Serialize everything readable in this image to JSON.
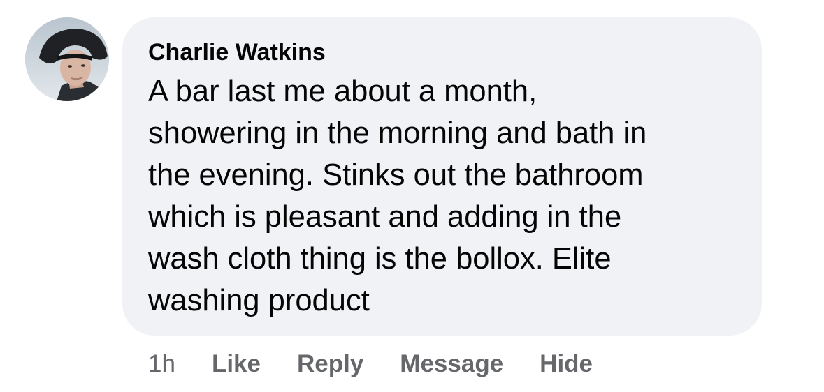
{
  "comment": {
    "author": "Charlie Watkins",
    "avatar_icon": "user-profile-photo",
    "text_lines": [
      "A bar last me about a month,",
      "showering in the morning and bath in",
      "the evening. Stinks out the bathroom",
      "which is pleasant and adding in the",
      "wash cloth thing is the bollox. Elite",
      "washing product"
    ],
    "timestamp": "1h",
    "actions": {
      "like": "Like",
      "reply": "Reply",
      "message": "Message",
      "hide": "Hide"
    }
  },
  "colors": {
    "bubble_background": "#f0f2f5",
    "text_primary": "#050505",
    "text_secondary": "#65676b"
  }
}
